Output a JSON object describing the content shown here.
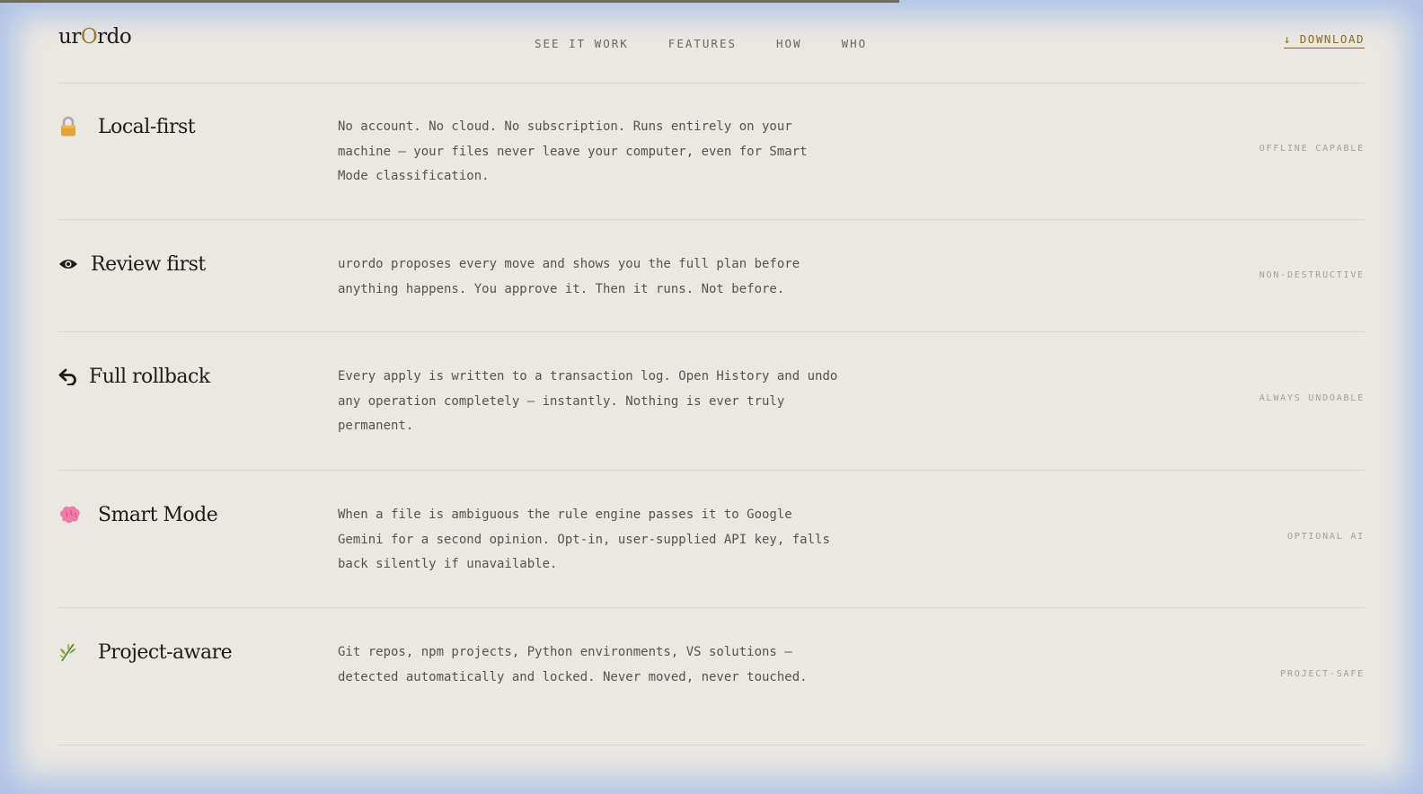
{
  "brand": {
    "prefix": "ur",
    "accent": "O",
    "suffix": "rdo",
    "accent_color": "#9a7a2c"
  },
  "nav": {
    "links": [
      "SEE IT WORK",
      "FEATURES",
      "HOW",
      "WHO"
    ],
    "download_label": "↓ DOWNLOAD"
  },
  "features": [
    {
      "icon": "lock-icon",
      "title": "Local-first",
      "description": "No account. No cloud. No subscription. Runs entirely on your machine — your files never leave your computer, even for Smart Mode classification.",
      "tag": "OFFLINE CAPABLE"
    },
    {
      "icon": "eye-icon",
      "title": "Review first",
      "description": "urordo proposes every move and shows you the full plan before anything happens. You approve it. Then it runs. Not before.",
      "tag": "NON-DESTRUCTIVE"
    },
    {
      "icon": "undo-arrow-icon",
      "title": "Full rollback",
      "description": "Every apply is written to a transaction log. Open History and undo any operation completely — instantly. Nothing is ever truly permanent.",
      "tag": "ALWAYS UNDOABLE"
    },
    {
      "icon": "brain-icon",
      "title": "Smart Mode",
      "description": "When a file is ambiguous the rule engine passes it to Google Gemini for a second opinion. Opt-in, user-supplied API key, falls back silently if unavailable.",
      "tag": "OPTIONAL AI"
    },
    {
      "icon": "herb-icon",
      "title": "Project-aware",
      "description": "Git repos, npm projects, Python environments, VS solutions — detected automatically and locked. Never moved, never touched.",
      "tag": "PROJECT-SAFE"
    }
  ]
}
